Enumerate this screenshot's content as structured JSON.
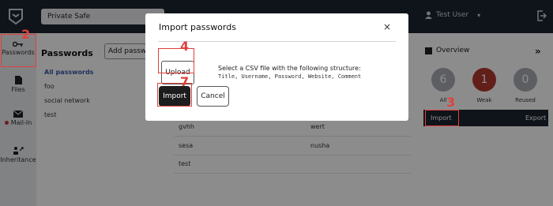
{
  "header": {
    "safe_select": "Private Safe",
    "user_name": "Test User",
    "icons": [
      "shield-logo-icon",
      "person-icon",
      "chevron-down-icon",
      "logout-icon"
    ]
  },
  "sidebar": {
    "items": [
      {
        "label": "Passwords",
        "icon": "key-icon"
      },
      {
        "label": "Files",
        "icon": "file-icon"
      },
      {
        "label": "Mail-In",
        "icon": "mail-icon"
      },
      {
        "label": "Inheritance",
        "icon": "inheritance-icon"
      }
    ]
  },
  "passwords": {
    "title": "Passwords",
    "add_button": "Add passw",
    "folders": [
      "All passwords",
      "foo",
      "social network",
      "test"
    ]
  },
  "table": {
    "rows": [
      {
        "title": "gvhh",
        "user": "wert"
      },
      {
        "title": "sesa",
        "user": "nusha"
      },
      {
        "title": "test",
        "user": ""
      }
    ]
  },
  "overview": {
    "title": "Overview",
    "collapse_label": "»",
    "stats": [
      {
        "value": "6",
        "label": "All",
        "color": "#a9acb2"
      },
      {
        "value": "1",
        "label": "Weak",
        "color": "#b23a2e"
      },
      {
        "value": "0",
        "label": "Reused",
        "color": "#a9acb2"
      }
    ],
    "import_label": "Import",
    "export_label": "Export"
  },
  "modal": {
    "title": "Import passwords",
    "close_label": "×",
    "upload_label": "Upload",
    "csv_text": "Select a CSV file with the following structure:",
    "csv_structure": "Title, Username, Password, Website, Comment",
    "import_label": "Import",
    "cancel_label": "Cancel"
  },
  "annotations": {
    "color": "#e0413b",
    "steps": [
      "2",
      "3",
      "4",
      "7"
    ]
  }
}
